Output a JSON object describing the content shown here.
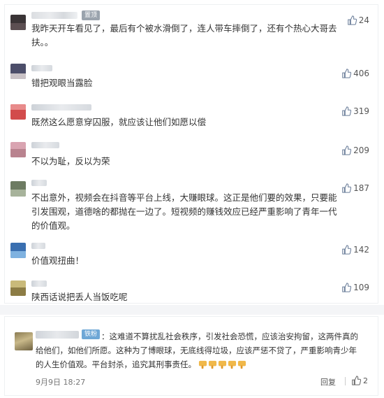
{
  "comments": [
    {
      "text": "我昨天开车看见了，最后有个被水滑倒了，连人带车摔倒了，还有个热心大哥去扶。。",
      "likes": "24",
      "tag": "置顶"
    },
    {
      "text": "错把观眼当露脸",
      "likes": "406"
    },
    {
      "text": "既然这么愿意穿囚服，就应该让他们如愿以偿",
      "likes": "319"
    },
    {
      "text": "不以为耻，反以为荣",
      "likes": "209"
    },
    {
      "text": "不出意外，视频会在抖音等平台上线，大赚眼球。这正是他们要的效果，只要能引发围观，道德啥的都抛在一边了。短视频的赚钱效应已经严重影响了青年一代的价值观。",
      "likes": "187"
    },
    {
      "text": "价值观扭曲！",
      "likes": "142"
    },
    {
      "text": "陕西话说把丢人当饭吃呢",
      "likes": "109"
    }
  ],
  "bottom": {
    "badge": "铁粉",
    "text": "：这难道不算扰乱社会秩序，引发社会恐慌，应该治安拘留，这两件真的给他们，如他们所愿。这种为了博眼球，无底线得垃圾，应该严惩不贷了，严重影响青少年的人生价值观。平台封杀，追究其刑事责任。",
    "date": "9月9日 18:27",
    "reply": "回复",
    "likes": "2"
  },
  "icons": {
    "like": "thumbs-up-icon",
    "emoji": "thumbs-down-emoji-icon"
  },
  "colors": {
    "text": "#333333",
    "meta": "#777777",
    "badge": "#6ea7d6"
  }
}
